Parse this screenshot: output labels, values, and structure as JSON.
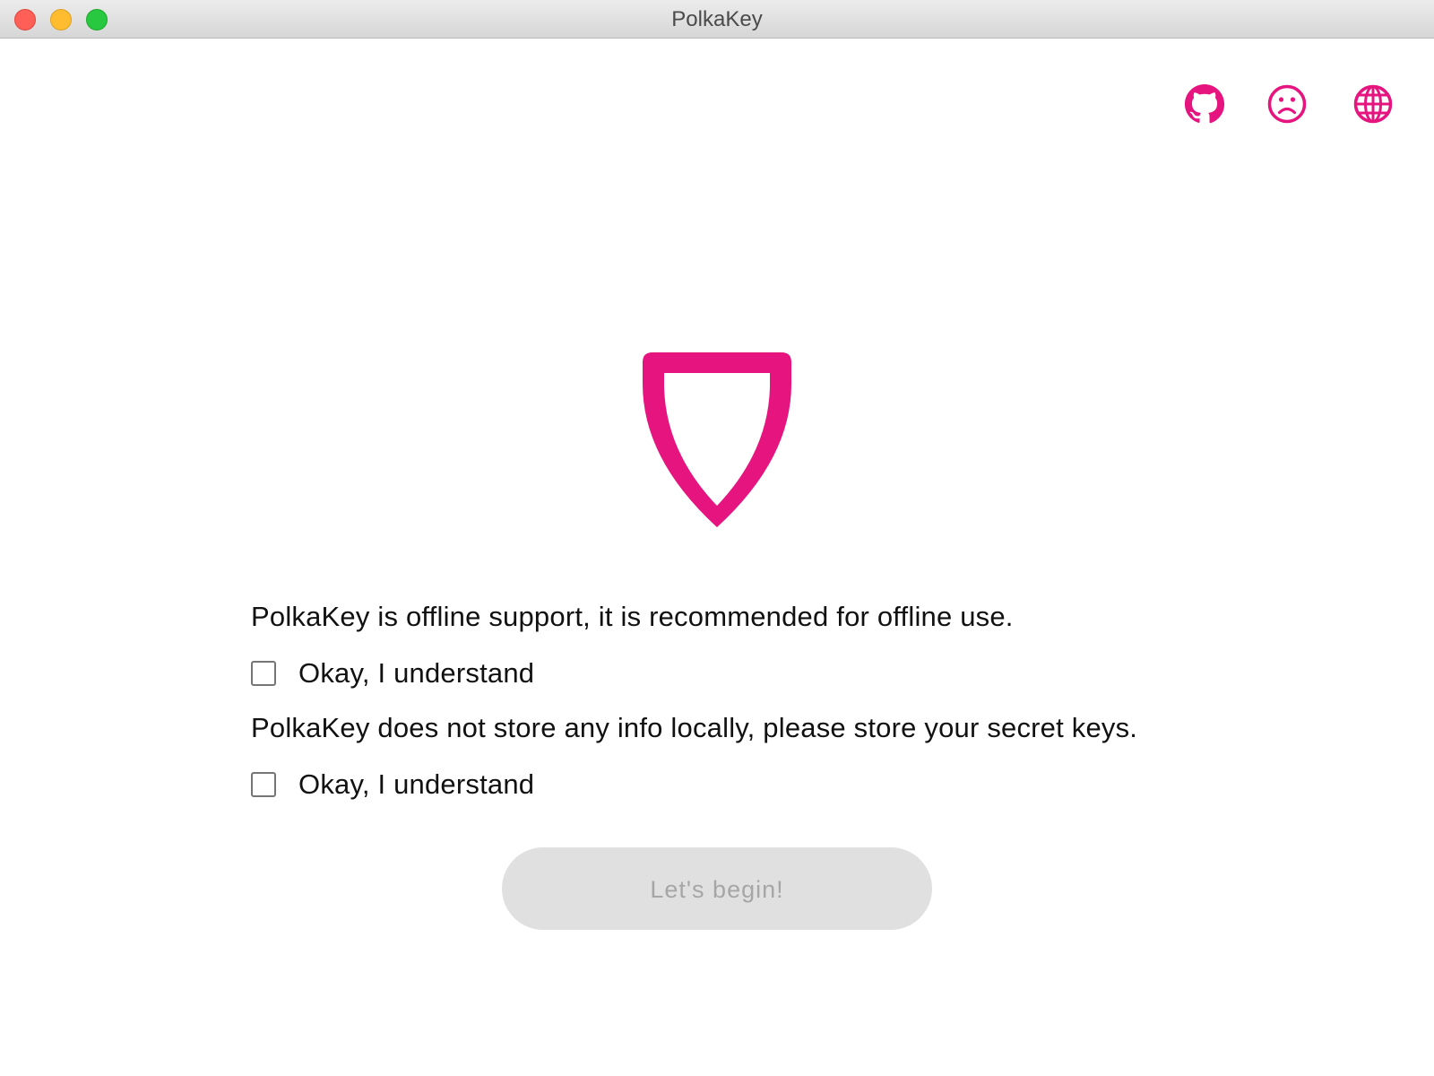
{
  "window": {
    "title": "PolkaKey"
  },
  "header": {
    "icons": [
      {
        "name": "github-icon",
        "color": "#e6147e"
      },
      {
        "name": "sad-face-icon",
        "color": "#e6147e"
      },
      {
        "name": "globe-icon",
        "color": "#e6147e"
      }
    ]
  },
  "brand": {
    "logo": "shield-icon",
    "accent_color": "#e6147e"
  },
  "notices": [
    {
      "text": "PolkaKey is offline support, it is recommended for offline use.",
      "checkbox_label": "Okay, I understand",
      "checked": false
    },
    {
      "text": "PolkaKey does not store any info locally, please store your secret keys.",
      "checkbox_label": "Okay, I understand",
      "checked": false
    }
  ],
  "actions": {
    "begin_label": "Let's begin!",
    "begin_enabled": false
  }
}
